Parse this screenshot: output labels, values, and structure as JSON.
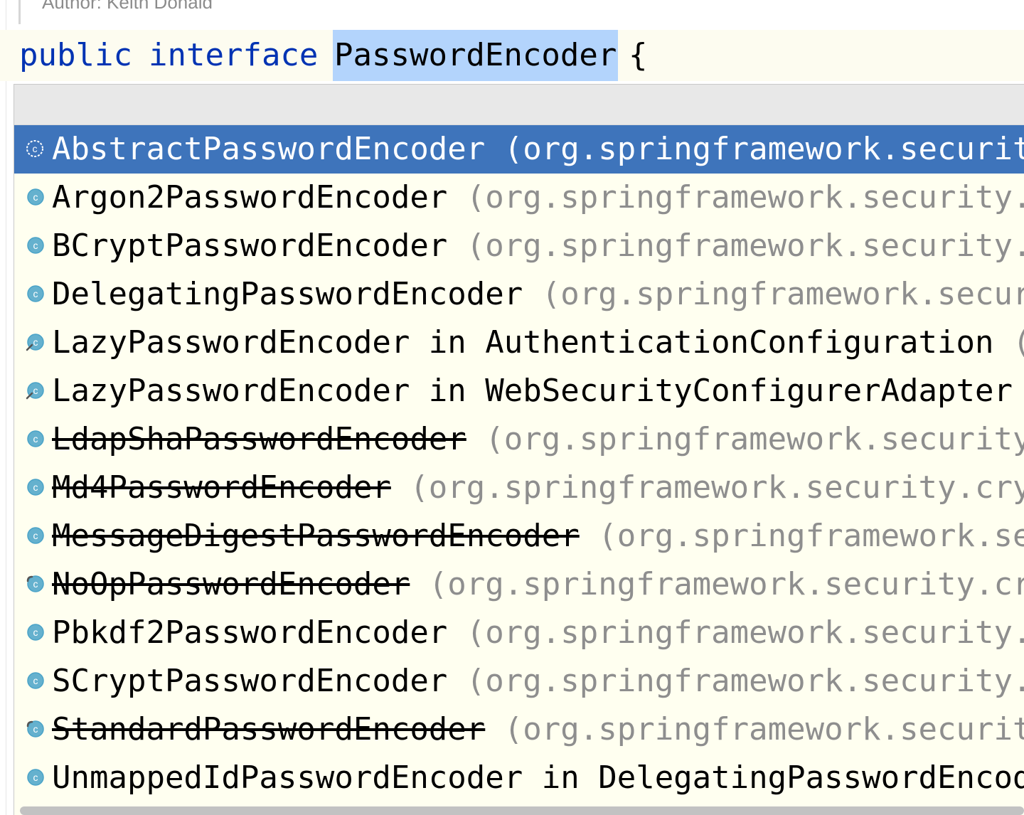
{
  "editor": {
    "doc_comment": "Author: Keith Donald",
    "code": {
      "kw_public": "public",
      "kw_interface": "interface",
      "identifier": "PasswordEncoder",
      "brace": "{"
    }
  },
  "completion": {
    "items": [
      {
        "name": "AbstractPasswordEncoder",
        "suffix": " (org.springframework.securit",
        "deprecated": false,
        "selected": true,
        "icon": "abstract-class-icon"
      },
      {
        "name": "Argon2PasswordEncoder",
        "suffix": " (org.springframework.security.",
        "deprecated": false,
        "selected": false,
        "icon": "class-icon"
      },
      {
        "name": "BCryptPasswordEncoder",
        "suffix": " (org.springframework.security.",
        "deprecated": false,
        "selected": false,
        "icon": "class-icon"
      },
      {
        "name": "DelegatingPasswordEncoder",
        "suffix": " (org.springframework.secur",
        "deprecated": false,
        "selected": false,
        "icon": "class-icon"
      },
      {
        "name": "LazyPasswordEncoder in AuthenticationConfiguration",
        "suffix": " (",
        "deprecated": false,
        "selected": false,
        "icon": "private-class-icon"
      },
      {
        "name": "LazyPasswordEncoder in WebSecurityConfigurerAdapter",
        "suffix": "",
        "deprecated": false,
        "selected": false,
        "icon": "private-class-icon"
      },
      {
        "name": "LdapShaPasswordEncoder",
        "suffix": " (org.springframework.security",
        "deprecated": true,
        "selected": false,
        "icon": "class-icon"
      },
      {
        "name": "Md4PasswordEncoder",
        "suffix": " (org.springframework.security.cry",
        "deprecated": true,
        "selected": false,
        "icon": "class-icon"
      },
      {
        "name": "MessageDigestPasswordEncoder",
        "suffix": " (org.springframework.se",
        "deprecated": true,
        "selected": false,
        "icon": "class-icon"
      },
      {
        "name": "NoOpPasswordEncoder",
        "suffix": " (org.springframework.security.cr",
        "deprecated": true,
        "selected": false,
        "icon": "final-class-icon"
      },
      {
        "name": "Pbkdf2PasswordEncoder",
        "suffix": " (org.springframework.security.",
        "deprecated": false,
        "selected": false,
        "icon": "class-icon"
      },
      {
        "name": "SCryptPasswordEncoder",
        "suffix": " (org.springframework.security.",
        "deprecated": false,
        "selected": false,
        "icon": "class-icon"
      },
      {
        "name": "StandardPasswordEncoder",
        "suffix": " (org.springframework.securit",
        "deprecated": true,
        "selected": false,
        "icon": "final-class-icon"
      },
      {
        "name": "UnmappedIdPasswordEncoder in DelegatingPasswordEncod",
        "suffix": "",
        "deprecated": false,
        "selected": false,
        "icon": "class-icon"
      }
    ]
  },
  "colors": {
    "keyword": "#0033b3",
    "selection_highlight": "#b3d4fc",
    "popup_background": "#fffff0",
    "selected_row": "#3e74bb",
    "package_text": "#8e8e8e",
    "class_icon": "#4aa3c8"
  }
}
